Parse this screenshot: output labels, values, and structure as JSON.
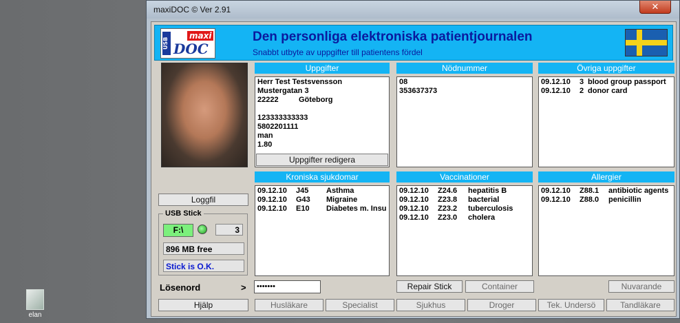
{
  "desktop": {
    "icon_label": "elan"
  },
  "window": {
    "title": "maxiDOC  ©   Ver 2.91",
    "close_label": "✕"
  },
  "header": {
    "logo_usb": "USB",
    "logo_maxi": "maxi",
    "logo_doc": "DOC",
    "title": "Den personliga elektroniska patientjournalen",
    "subtitle": "Snabbt utbyte av uppgifter till patientens fördel",
    "flag": "swedish-flag"
  },
  "uppgifter": {
    "header": "Uppgifter",
    "lines": [
      "Herr Test  Testsvensson",
      "Mustergatan 3",
      "22222",
      "Göteborg",
      "123333333333",
      "5802201111",
      "man",
      "1.80"
    ],
    "edit_button": "Uppgifter redigera"
  },
  "nodnummer": {
    "header": "Nödnummer",
    "lines": [
      "08",
      "353637373"
    ]
  },
  "ovriga": {
    "header": "Övriga uppgifter",
    "rows": [
      {
        "date": "09.12.10",
        "num": "3",
        "text": "blood group passport"
      },
      {
        "date": "09.12.10",
        "num": "2",
        "text": "donor card"
      }
    ]
  },
  "kroniska": {
    "header": "Kroniska sjukdomar",
    "rows": [
      {
        "date": "09.12.10",
        "code": "J45",
        "text": "Asthma"
      },
      {
        "date": "09.12.10",
        "code": "G43",
        "text": "Migraine"
      },
      {
        "date": "09.12.10",
        "code": "E10",
        "text": "Diabetes m. Insu"
      }
    ]
  },
  "vaccinationer": {
    "header": "Vaccinationer",
    "rows": [
      {
        "date": "09.12.10",
        "code": "Z24.6",
        "text": "hepatitis B"
      },
      {
        "date": "09.12.10",
        "code": "Z23.8",
        "text": "bacterial"
      },
      {
        "date": "09.12.10",
        "code": "Z23.2",
        "text": "tuberculosis"
      },
      {
        "date": "09.12.10",
        "code": "Z23.0",
        "text": "cholera"
      }
    ]
  },
  "allergier": {
    "header": "Allergier",
    "rows": [
      {
        "date": "09.12.10",
        "code": "Z88.1",
        "text": "antibiotic agents"
      },
      {
        "date": "09.12.10",
        "code": "Z88.0",
        "text": "penicillin"
      }
    ]
  },
  "left": {
    "loggfil": "Loggfil",
    "usb_caption": "USB Stick",
    "drive": "F:\\",
    "count": "3",
    "free": "896 MB free",
    "status": "Stick is O.K.",
    "password_label": "Lösenord",
    "password_arrow": ">",
    "password_value": "•••••••",
    "help": "Hjälp"
  },
  "buttons": {
    "repair": "Repair Stick",
    "container": "Container",
    "nuvarande": "Nuvarande",
    "huslakare": "Husläkare",
    "specialist": "Specialist",
    "sjukhus": "Sjukhus",
    "droger": "Droger",
    "tek": "Tek. Undersö",
    "tandlakare": "Tandläkare"
  }
}
